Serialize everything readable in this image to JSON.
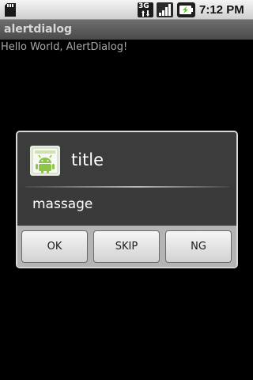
{
  "status_bar": {
    "network_type": "3G",
    "time": "7:12 PM",
    "icons": [
      "sd-card-icon",
      "network-3g-icon",
      "signal-icon",
      "battery-charging-icon"
    ]
  },
  "app": {
    "title": "alertdialog",
    "content_text": "Hello World, AlertDialog!"
  },
  "dialog": {
    "icon": "android-app-icon",
    "title": "title",
    "message": "massage",
    "buttons": {
      "positive": "OK",
      "neutral": "SKIP",
      "negative": "NG"
    }
  },
  "colors": {
    "background": "#000000",
    "dialog_body": "#3a3a3a",
    "button_bar": "#b4b4b4",
    "android_green": "#8ec449"
  }
}
